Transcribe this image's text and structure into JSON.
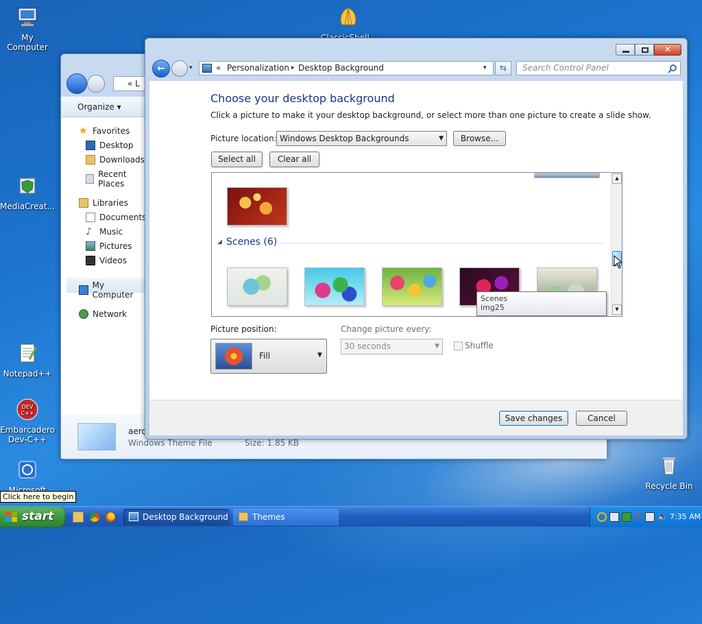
{
  "desktop": {
    "icons": [
      {
        "label": "My Computer"
      },
      {
        "label": "ClassicShell..."
      },
      {
        "label": "MediaCreat..."
      },
      {
        "label": "Notepad++"
      },
      {
        "label": "Embarcadero Dev-C++"
      },
      {
        "label": "Microsoft"
      },
      {
        "label": "Recycle Bin"
      }
    ],
    "tooltip": "Click here to begin"
  },
  "explorer": {
    "address_partial": "L",
    "toolbar": {
      "organize": "Organize"
    },
    "nav": {
      "favorites": "Favorites",
      "desktop": "Desktop",
      "downloads": "Downloads",
      "recent": "Recent Places",
      "libraries": "Libraries",
      "documents": "Documents",
      "music": "Music",
      "pictures": "Pictures",
      "videos": "Videos",
      "computer": "My Computer",
      "network": "Network"
    },
    "details": {
      "name": "aero",
      "type": "Windows Theme File",
      "size": "Size: 1.85 KB"
    }
  },
  "dialog": {
    "breadcrumb": {
      "root": "Personalization",
      "current": "Desktop Background"
    },
    "search_placeholder": "Search Control Panel",
    "heading": "Choose your desktop background",
    "subheading": "Click a picture to make it your desktop background, or select more than one picture to create a slide show.",
    "picture_location_label": "Picture location:",
    "picture_location_value": "Windows Desktop Backgrounds",
    "browse_label": "Browse...",
    "select_all_label": "Select all",
    "clear_all_label": "Clear all",
    "group_label": "Scenes (6)",
    "tooltip": {
      "title": "Scenes",
      "name": "img25"
    },
    "picture_position_label": "Picture position:",
    "picture_position_value": "Fill",
    "change_every_label": "Change picture every:",
    "change_every_value": "30 seconds",
    "shuffle_label": "Shuffle",
    "save_label": "Save changes",
    "cancel_label": "Cancel"
  },
  "taskbar": {
    "start_label": "start",
    "tasks": [
      {
        "label": "Desktop Background"
      },
      {
        "label": "Themes"
      }
    ],
    "clock": "7:35 AM"
  },
  "colors": {
    "heading": "#1e3287",
    "desktop": "#1c74cf",
    "start": "#3c9a3c"
  }
}
